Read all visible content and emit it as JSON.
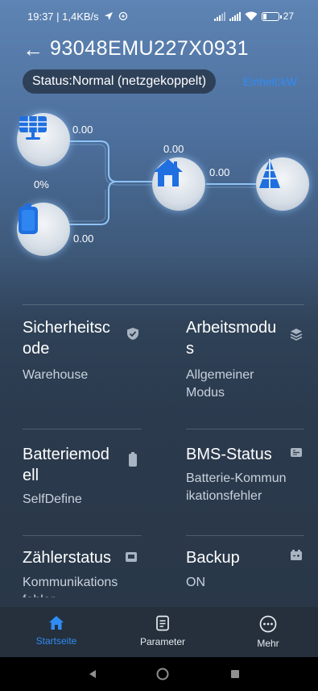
{
  "statusbar": {
    "time_net": "19:37 | 1,4KB/s",
    "battery_pct": "27",
    "battery_level": 0.27
  },
  "header": {
    "back_glyph": "←",
    "title": "93048EMU227X0931"
  },
  "status": {
    "text": "Status:Normal (netzgekoppelt)",
    "unit_link": "Einheit:kW"
  },
  "flow": {
    "pv_value": "0.00",
    "battery_soc": "0%",
    "battery_value": "0.00",
    "home_value": "0.00",
    "grid_value": "0.00",
    "line_color": "#8ec3f5",
    "icon_blue": "#1f6fe0"
  },
  "cards": [
    {
      "title": "Sicherheitscode",
      "title_wrap": [
        "Sicherheitsc",
        "ode"
      ],
      "value": "Warehouse",
      "icon": "shield-check-icon"
    },
    {
      "title": "Arbeitsmodus",
      "title_wrap": [
        "Arbeitsmodu",
        "s"
      ],
      "value_wrap": [
        "Allgemeiner",
        "Modus"
      ],
      "icon": "layers-icon"
    },
    {
      "title": "Batteriemodell",
      "title_wrap": [
        "Batteriemod",
        "ell"
      ],
      "value": "SelfDefine",
      "icon": "battery-icon"
    },
    {
      "title": "BMS-Status",
      "value_wrap": [
        "Batterie-Kommun",
        "ikationsfehler"
      ],
      "icon": "bms-icon"
    },
    {
      "title": "Zählerstatus",
      "value_wrap": [
        "Kommunikations",
        "fehler"
      ],
      "icon": "meter-icon"
    },
    {
      "title": "Backup",
      "value": "ON",
      "icon": "backup-battery-icon"
    }
  ],
  "nav": {
    "home": "Startseite",
    "params": "Parameter",
    "more": "Mehr",
    "accent": "#2f8cf5"
  }
}
